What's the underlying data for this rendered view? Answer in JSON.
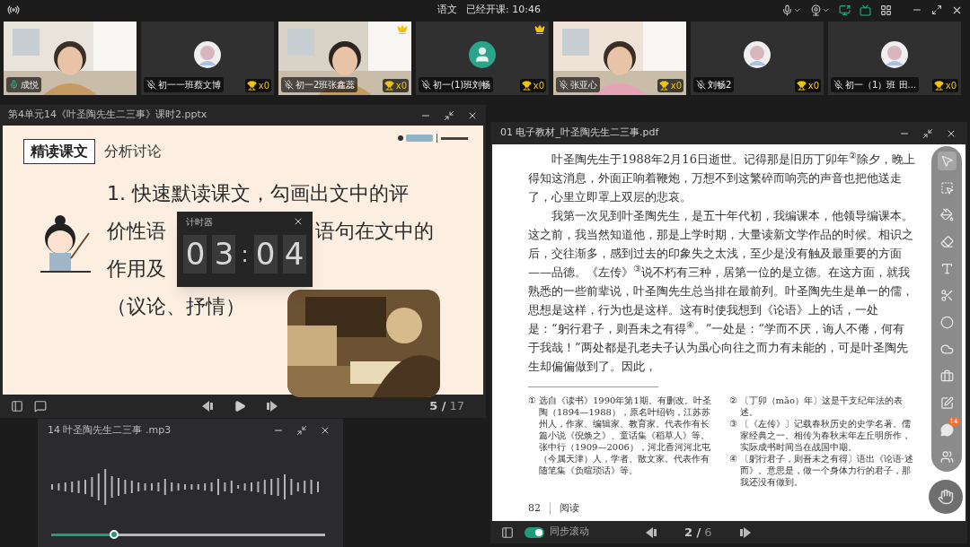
{
  "top_bar": {
    "subject": "语文",
    "status": "已经开课: 10:46"
  },
  "participants": [
    {
      "name": "成悦",
      "kind": "video",
      "speaking": true,
      "crown": false
    },
    {
      "name": "初一一班蔡文博",
      "kind": "avatar",
      "speaking": false,
      "crown": false,
      "trophy": "x0"
    },
    {
      "name": "初一2班张鑫蕊",
      "kind": "video",
      "speaking": false,
      "crown": true,
      "trophy": "x0"
    },
    {
      "name": "初一(1)班刘畅",
      "kind": "default_avatar",
      "speaking": false,
      "crown": true,
      "trophy": "x0"
    },
    {
      "name": "张亚心",
      "kind": "video",
      "speaking": false,
      "crown": false,
      "trophy": "x0"
    },
    {
      "name": "刘畅2",
      "kind": "avatar",
      "speaking": false,
      "crown": false,
      "trophy": "x0"
    },
    {
      "name": "初一（1）班 田...",
      "kind": "avatar",
      "speaking": false,
      "crown": false,
      "trophy": "x0"
    }
  ],
  "slides": {
    "title": "第4单元14《叶圣陶先生二三事》课时2.pptx",
    "tag": "精读课文",
    "heading": "分析讨论",
    "lines": [
      {
        "parts": [
          "1. 快速默读课文，勾画出文中的评"
        ]
      },
      {
        "parts": [
          "价性语",
          "语句在文中的"
        ]
      },
      {
        "parts": [
          "作用及"
        ]
      },
      {
        "parts": [
          "（议论、抒情）"
        ]
      }
    ],
    "page_current": "5 /",
    "page_total": "17"
  },
  "timer": {
    "title": "计时器",
    "digits": [
      "0",
      "3",
      "0",
      "4"
    ],
    "separator": ":"
  },
  "audio": {
    "title": "14 叶圣陶先生二三事 .mp3",
    "level": 0.23
  },
  "pdf": {
    "title": "01 电子教材_叶圣陶先生二三事.pdf",
    "paragraphs": [
      "叶圣陶先生于1988年2月16日逝世。记得那是旧历丁卯年$^{②}$除夕，晚上得知这消息，外面正响着鞭炮，万想不到这繁碎而响亮的声音也把他送走了，心里立即罩上双层的悲哀。",
      "我第一次见到叶圣陶先生，是五十年代初，我编课本，他领导编课本。这之前，我当然知道他，那是上学时期，大量读新文学作品的时候。相识之后，交往渐多，感到过去的印象失之太浅，至少是没有触及最重要的方面——品德。《左传》$^{③}$说不朽有三种，居第一位的是立德。在这方面，就我熟悉的一些前辈说，叶圣陶先生总当排在最前列。叶圣陶先生是单一的儒，思想是这样，行为也是这样。这有时使我想到《论语》上的话，一处是：“躬行君子，则吾未之有得$^{④}$。”一处是：“学而不厌，诲人不倦，何有于我哉！”两处都是孔老夫子认为虽心向往之而力有未能的，可是叶圣陶先生却偏偏做到了。因此，"
    ],
    "footnote_columns": [
      {
        "notes": [
          {
            "mark": "①",
            "text": "选自《读书》1990年第1期。有删改。叶圣陶（1894—1988），原名叶绍钧，江苏苏州人，作家、编辑家、教育家。代表作有长篇小说《倪焕之》、童话集《稻草人》等。张中行（1909—2006），河北香河河北屯（今属天津）人，学者、散文家。代表作有随笔集《负暄琐话》等。"
          }
        ]
      },
      {
        "notes": [
          {
            "mark": "②",
            "text": "〔丁卯（mǎo）年〕这是干支纪年法的表述。"
          },
          {
            "mark": "③",
            "text": "〔《左传》〕记载春秋历史的史学名著。儒家经典之一。相传为春秋末年左丘明所作，实际成书时间当在战国中期。"
          },
          {
            "mark": "④",
            "text": "〔躬行君子，则吾未之有得〕语出《论语·述而》。意思是，做一个身体力行的君子，那我还没有做到。"
          }
        ]
      }
    ],
    "page_number": "82",
    "section": "阅读",
    "chat_badge": "14",
    "sync": {
      "label": "同步滚动",
      "on": true
    },
    "page_current": "2 /",
    "page_total": "6"
  }
}
